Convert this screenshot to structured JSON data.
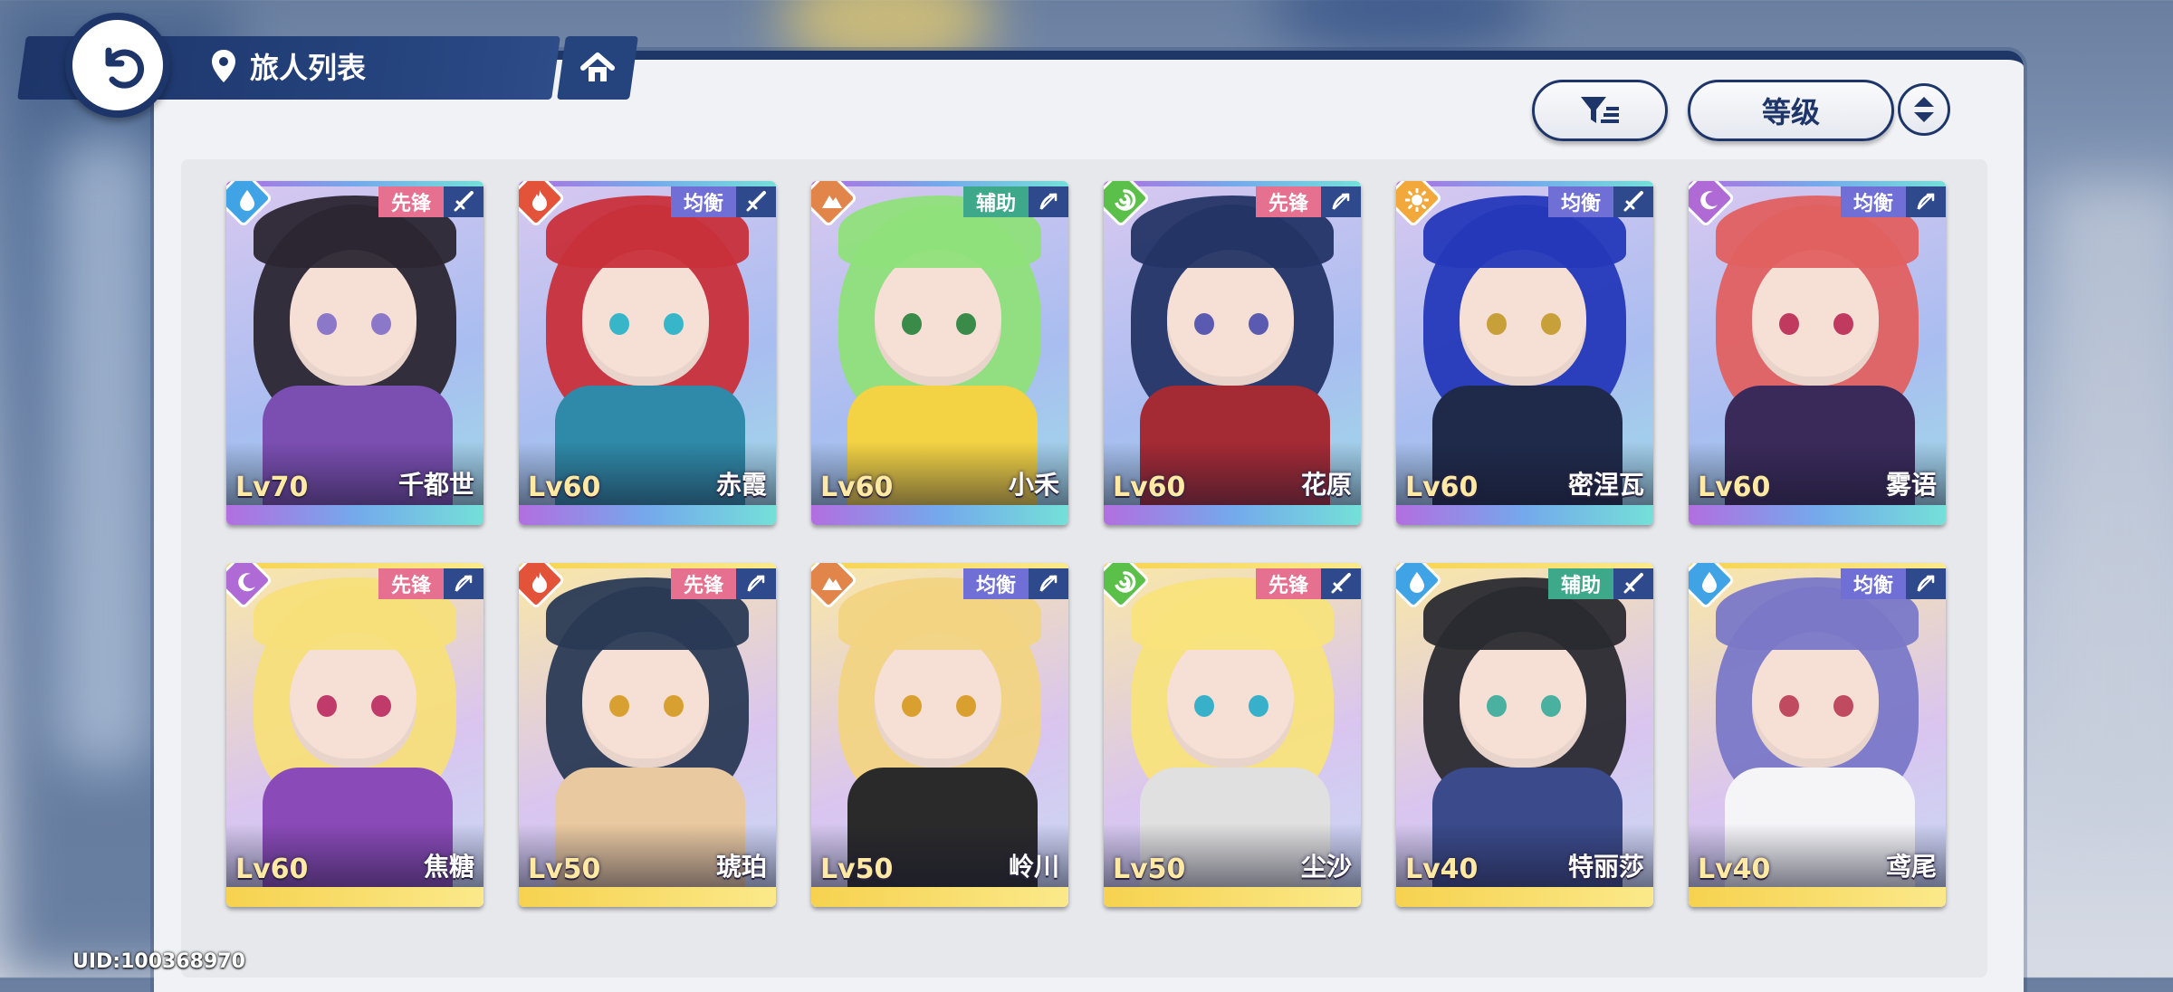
{
  "header": {
    "location_title": "旅人列表"
  },
  "controls": {
    "sort_label": "等级"
  },
  "uid": "UID:100368970",
  "colors": {
    "navy": "#1d3569",
    "vanguard": "#e6708f",
    "balanced": "#6f6fd6",
    "support": "#3ea88b",
    "bar_purple_blue": "linear-gradient(90deg,#b26ee0,#74a9ec,#74e0d8)",
    "bar_gold": "linear-gradient(90deg,#f6d24f,#fbe98a)"
  },
  "characters": [
    {
      "name": "千都世",
      "level": "Lv70",
      "role": "先锋",
      "element": "water",
      "weapon": "sword",
      "hair": "#2b2632",
      "accent": "#7b4fb2",
      "eyes": "#8c78c8",
      "rarity": "purple"
    },
    {
      "name": "赤霞",
      "level": "Lv60",
      "role": "均衡",
      "element": "fire",
      "weapon": "sword",
      "hair": "#c8303a",
      "accent": "#2e8aa8",
      "eyes": "#38b6c9",
      "rarity": "purple"
    },
    {
      "name": "小禾",
      "level": "Lv60",
      "role": "辅助",
      "element": "earth",
      "weapon": "bow",
      "hair": "#8fe07a",
      "accent": "#f3d343",
      "eyes": "#3a8a4a",
      "rarity": "purple"
    },
    {
      "name": "花原",
      "level": "Lv60",
      "role": "先锋",
      "element": "wind",
      "weapon": "bow",
      "hair": "#243465",
      "accent": "#a42a34",
      "eyes": "#5a5ab0",
      "rarity": "purple"
    },
    {
      "name": "密涅瓦",
      "level": "Lv60",
      "role": "均衡",
      "element": "light",
      "weapon": "sword",
      "hair": "#2438b8",
      "accent": "#1f2a4a",
      "eyes": "#c8a03a",
      "rarity": "purple"
    },
    {
      "name": "雾语",
      "level": "Lv60",
      "role": "均衡",
      "element": "dark",
      "weapon": "bow",
      "hair": "#e06060",
      "accent": "#3a2a5a",
      "eyes": "#c03a60",
      "rarity": "purple"
    },
    {
      "name": "焦糖",
      "level": "Lv60",
      "role": "先锋",
      "element": "dark",
      "weapon": "bow",
      "hair": "#f7df7a",
      "accent": "#8a4ab8",
      "eyes": "#c03a6a",
      "rarity": "gold"
    },
    {
      "name": "琥珀",
      "level": "Lv50",
      "role": "先锋",
      "element": "fire",
      "weapon": "bow",
      "hair": "#2a3a55",
      "accent": "#e9c9a0",
      "eyes": "#d8a030",
      "rarity": "gold"
    },
    {
      "name": "岭川",
      "level": "Lv50",
      "role": "均衡",
      "element": "earth",
      "weapon": "bow",
      "hair": "#f2d483",
      "accent": "#2a2a2a",
      "eyes": "#d9a030",
      "rarity": "gold"
    },
    {
      "name": "尘沙",
      "level": "Lv50",
      "role": "先锋",
      "element": "wind",
      "weapon": "sword",
      "hair": "#f8e37c",
      "accent": "#e0e0e0",
      "eyes": "#38b0c9",
      "rarity": "gold"
    },
    {
      "name": "特丽莎",
      "level": "Lv40",
      "role": "辅助",
      "element": "water",
      "weapon": "sword",
      "hair": "#2a2a30",
      "accent": "#3a4a8a",
      "eyes": "#4ab0a0",
      "rarity": "gold"
    },
    {
      "name": "鸢尾",
      "level": "Lv40",
      "role": "均衡",
      "element": "water",
      "weapon": "bow",
      "hair": "#7a78c8",
      "accent": "#f5f5f8",
      "eyes": "#c04a60",
      "rarity": "gold"
    }
  ]
}
